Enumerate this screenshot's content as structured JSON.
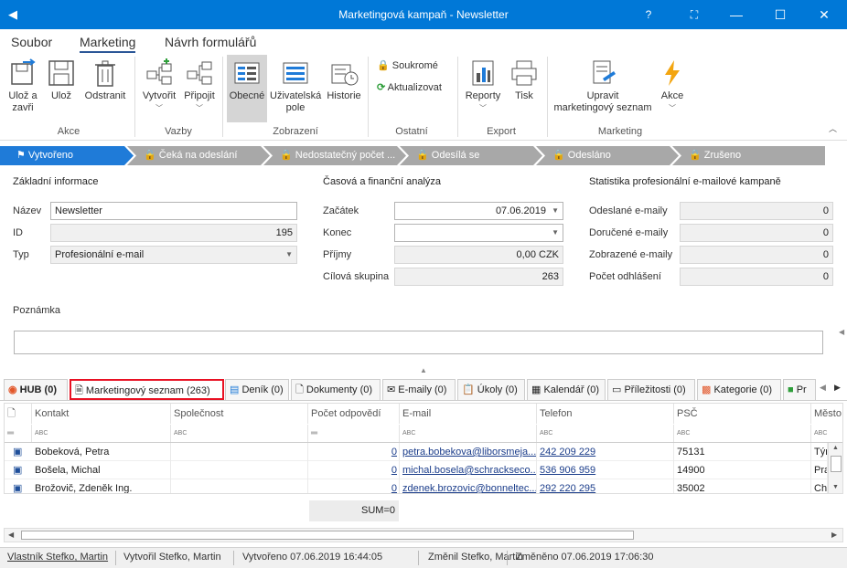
{
  "window": {
    "title": "Marketingová kampaň - Newsletter",
    "help": "?",
    "minimize": "—",
    "maximize": "☐",
    "close": "✕",
    "restore": "⛶"
  },
  "ribbon_tabs": [
    "Soubor",
    "Marketing",
    "Návrh formulářů"
  ],
  "ribbon": {
    "akce": {
      "label": "Akce",
      "save_close": "Ulož a\nzavři",
      "save": "Ulož",
      "delete": "Odstranit"
    },
    "vazby": {
      "label": "Vazby",
      "create": "Vytvořit",
      "attach": "Připojit"
    },
    "zobrazeni": {
      "label": "Zobrazení",
      "general": "Obecné",
      "user_fields": "Uživatelská\npole",
      "history": "Historie"
    },
    "ostatni": {
      "label": "Ostatní",
      "private": "Soukromé",
      "refresh": "Aktualizovat"
    },
    "export": {
      "label": "Export",
      "reports": "Reporty",
      "print": "Tisk"
    },
    "marketing": {
      "label": "Marketing",
      "edit_list": "Upravit\nmarketingový seznam",
      "action": "Akce"
    }
  },
  "workflow": [
    "Vytvořeno",
    "Čeká na odeslání",
    "Nedostatečný počet ...",
    "Odesílá se",
    "Odesláno",
    "Zrušeno"
  ],
  "basic": {
    "section": "Základní informace",
    "name_label": "Název",
    "name": "Newsletter",
    "id_label": "ID",
    "id": "195",
    "type_label": "Typ",
    "type": "Profesionální e-mail"
  },
  "finance": {
    "section": "Časová a finanční analýza",
    "start_label": "Začátek",
    "start": "07.06.2019",
    "end_label": "Konec",
    "end": "",
    "income_label": "Příjmy",
    "income": "0,00 CZK",
    "target_label": "Cílová skupina",
    "target": "263"
  },
  "stats": {
    "section": "Statistika profesionální e-mailové kampaně",
    "sent_label": "Odeslané e-maily",
    "sent": "0",
    "delivered_label": "Doručené e-maily",
    "delivered": "0",
    "shown_label": "Zobrazené e-maily",
    "shown": "0",
    "unsub_label": "Počet odhlášení",
    "unsub": "0"
  },
  "note": {
    "label": "Poznámka",
    "value": ""
  },
  "tabs": [
    "HUB (0)",
    "Marketingový seznam (263)",
    "Deník (0)",
    "Dokumenty (0)",
    "E-maily (0)",
    "Úkoly (0)",
    "Kalendář (0)",
    "Příležitosti (0)",
    "Kategorie (0)",
    "Pr"
  ],
  "grid": {
    "columns": [
      "Kontakt",
      "Společnost",
      "Počet odpovědí",
      "E-mail",
      "Telefon",
      "PSČ",
      "Město"
    ],
    "filter_tag": "ABC",
    "rows": [
      [
        "Bobeková, Petra",
        "",
        "0",
        "petra.bobekova@liborsmeja...",
        "242 209 229",
        "75131",
        "Týr"
      ],
      [
        "Bošela, Michal",
        "",
        "0",
        "michal.bosela@schrackseco...",
        "536 906 959",
        "14900",
        "Pra"
      ],
      [
        "Brožovič, Zdeněk Ing.",
        "",
        "0",
        "zdenek.brozovic@bonneltec...",
        "292 220 295",
        "35002",
        "Che"
      ]
    ],
    "sum": "SUM=0"
  },
  "status": {
    "owner": "Vlastník Stefko, Martin",
    "creator": "Vytvořil Stefko, Martin",
    "created": "Vytvořeno 07.06.2019 16:44:05",
    "changer": "Změnil Stefko, Martin",
    "changed": "Změněno 07.06.2019 17:06:30"
  }
}
